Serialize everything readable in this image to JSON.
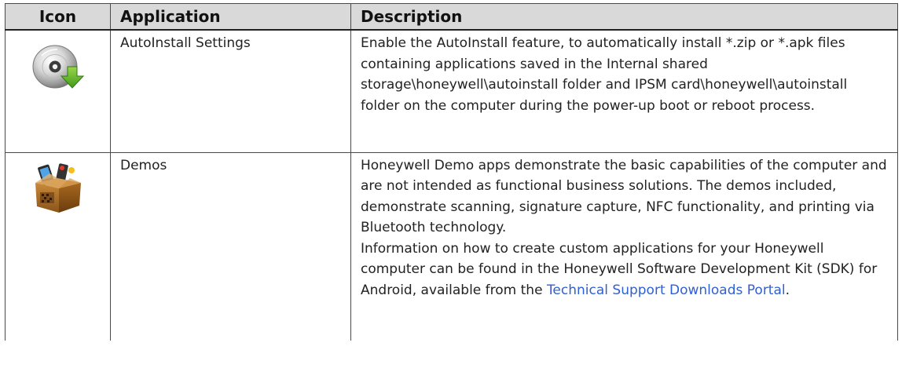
{
  "header": {
    "icon": "Icon",
    "application": "Application",
    "description": "Description"
  },
  "rows": [
    {
      "icon_name": "autoinstall-disc-icon",
      "application": "AutoInstall Settings",
      "description": "Enable the AutoInstall feature, to automatically install *.zip or *.apk files containing applications saved in the Internal shared storage\\honeywell\\autoinstall folder and IPSM card\\honeywell\\autoinstall folder on the computer during the power-up boot or reboot process."
    },
    {
      "icon_name": "demos-box-icon",
      "application": "Demos",
      "description": "Honeywell Demo apps demonstrate the basic capabilities of the computer and are not intended as functional business solutions. The demos included, demonstrate scanning, signature capture, NFC functionality, and printing via Bluetooth technology.",
      "description_2_pre": "Information on how to create custom applications for your Honeywell computer can be found in the Honeywell Software Development Kit (SDK) for Android, available from the ",
      "description_2_link": "Technical Support Downloads Portal",
      "description_2_post": "."
    }
  ],
  "colors": {
    "header_bg": "#d9d9d9",
    "link": "#2f5fd4",
    "border": "#4a4a4a"
  }
}
